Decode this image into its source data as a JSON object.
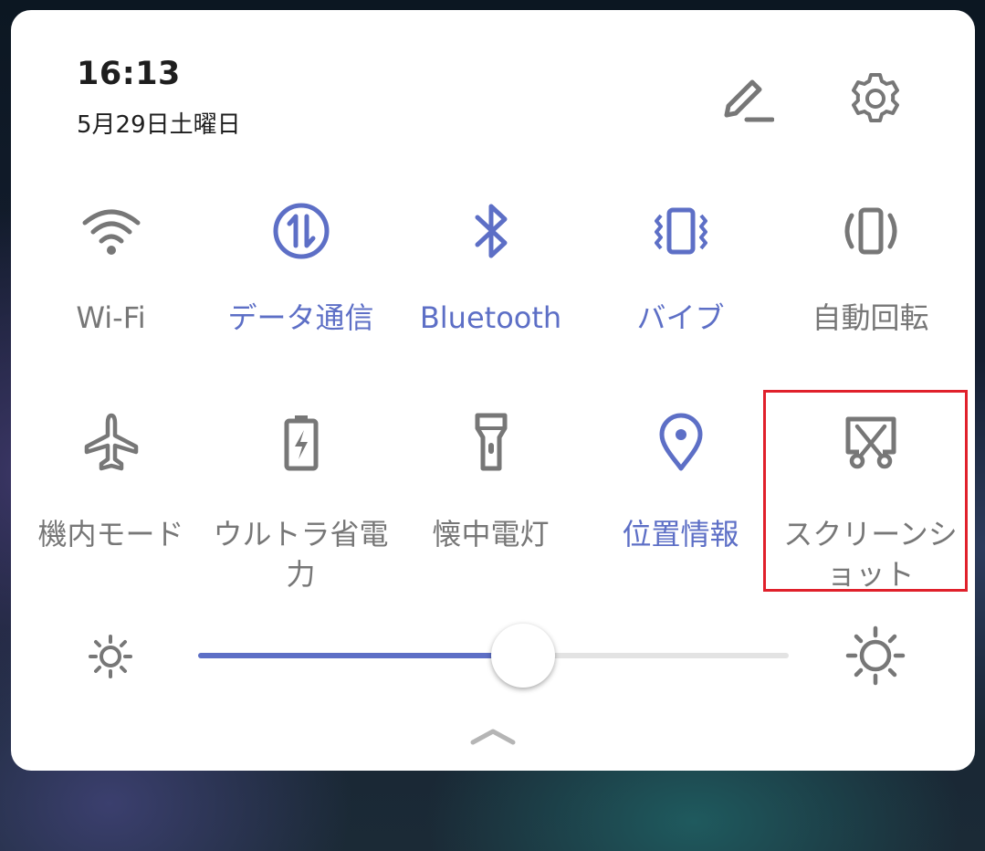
{
  "header": {
    "time": "16:13",
    "date": "5月29日土曜日"
  },
  "tiles_row1": [
    {
      "label": "Wi-Fi",
      "icon": "wifi-icon",
      "active": false
    },
    {
      "label": "データ通信",
      "icon": "mobile-data-icon",
      "active": true
    },
    {
      "label": "Bluetooth",
      "icon": "bluetooth-icon",
      "active": true
    },
    {
      "label": "バイブ",
      "icon": "vibrate-icon",
      "active": true
    },
    {
      "label": "自動回転",
      "icon": "auto-rotate-icon",
      "active": false
    }
  ],
  "tiles_row2": [
    {
      "label": "機内モード",
      "icon": "airplane-icon",
      "active": false
    },
    {
      "label": "ウルトラ省電力",
      "icon": "battery-saver-icon",
      "active": false
    },
    {
      "label": "懐中電灯",
      "icon": "flashlight-icon",
      "active": false
    },
    {
      "label": "位置情報",
      "icon": "location-icon",
      "active": true
    },
    {
      "label": "スクリーンショット",
      "icon": "screenshot-icon",
      "active": false,
      "highlighted": true
    }
  ],
  "brightness": {
    "level": 0.55
  },
  "colors": {
    "accent": "#5d6fc6",
    "inactive": "#777777",
    "highlight": "#e0202b"
  }
}
